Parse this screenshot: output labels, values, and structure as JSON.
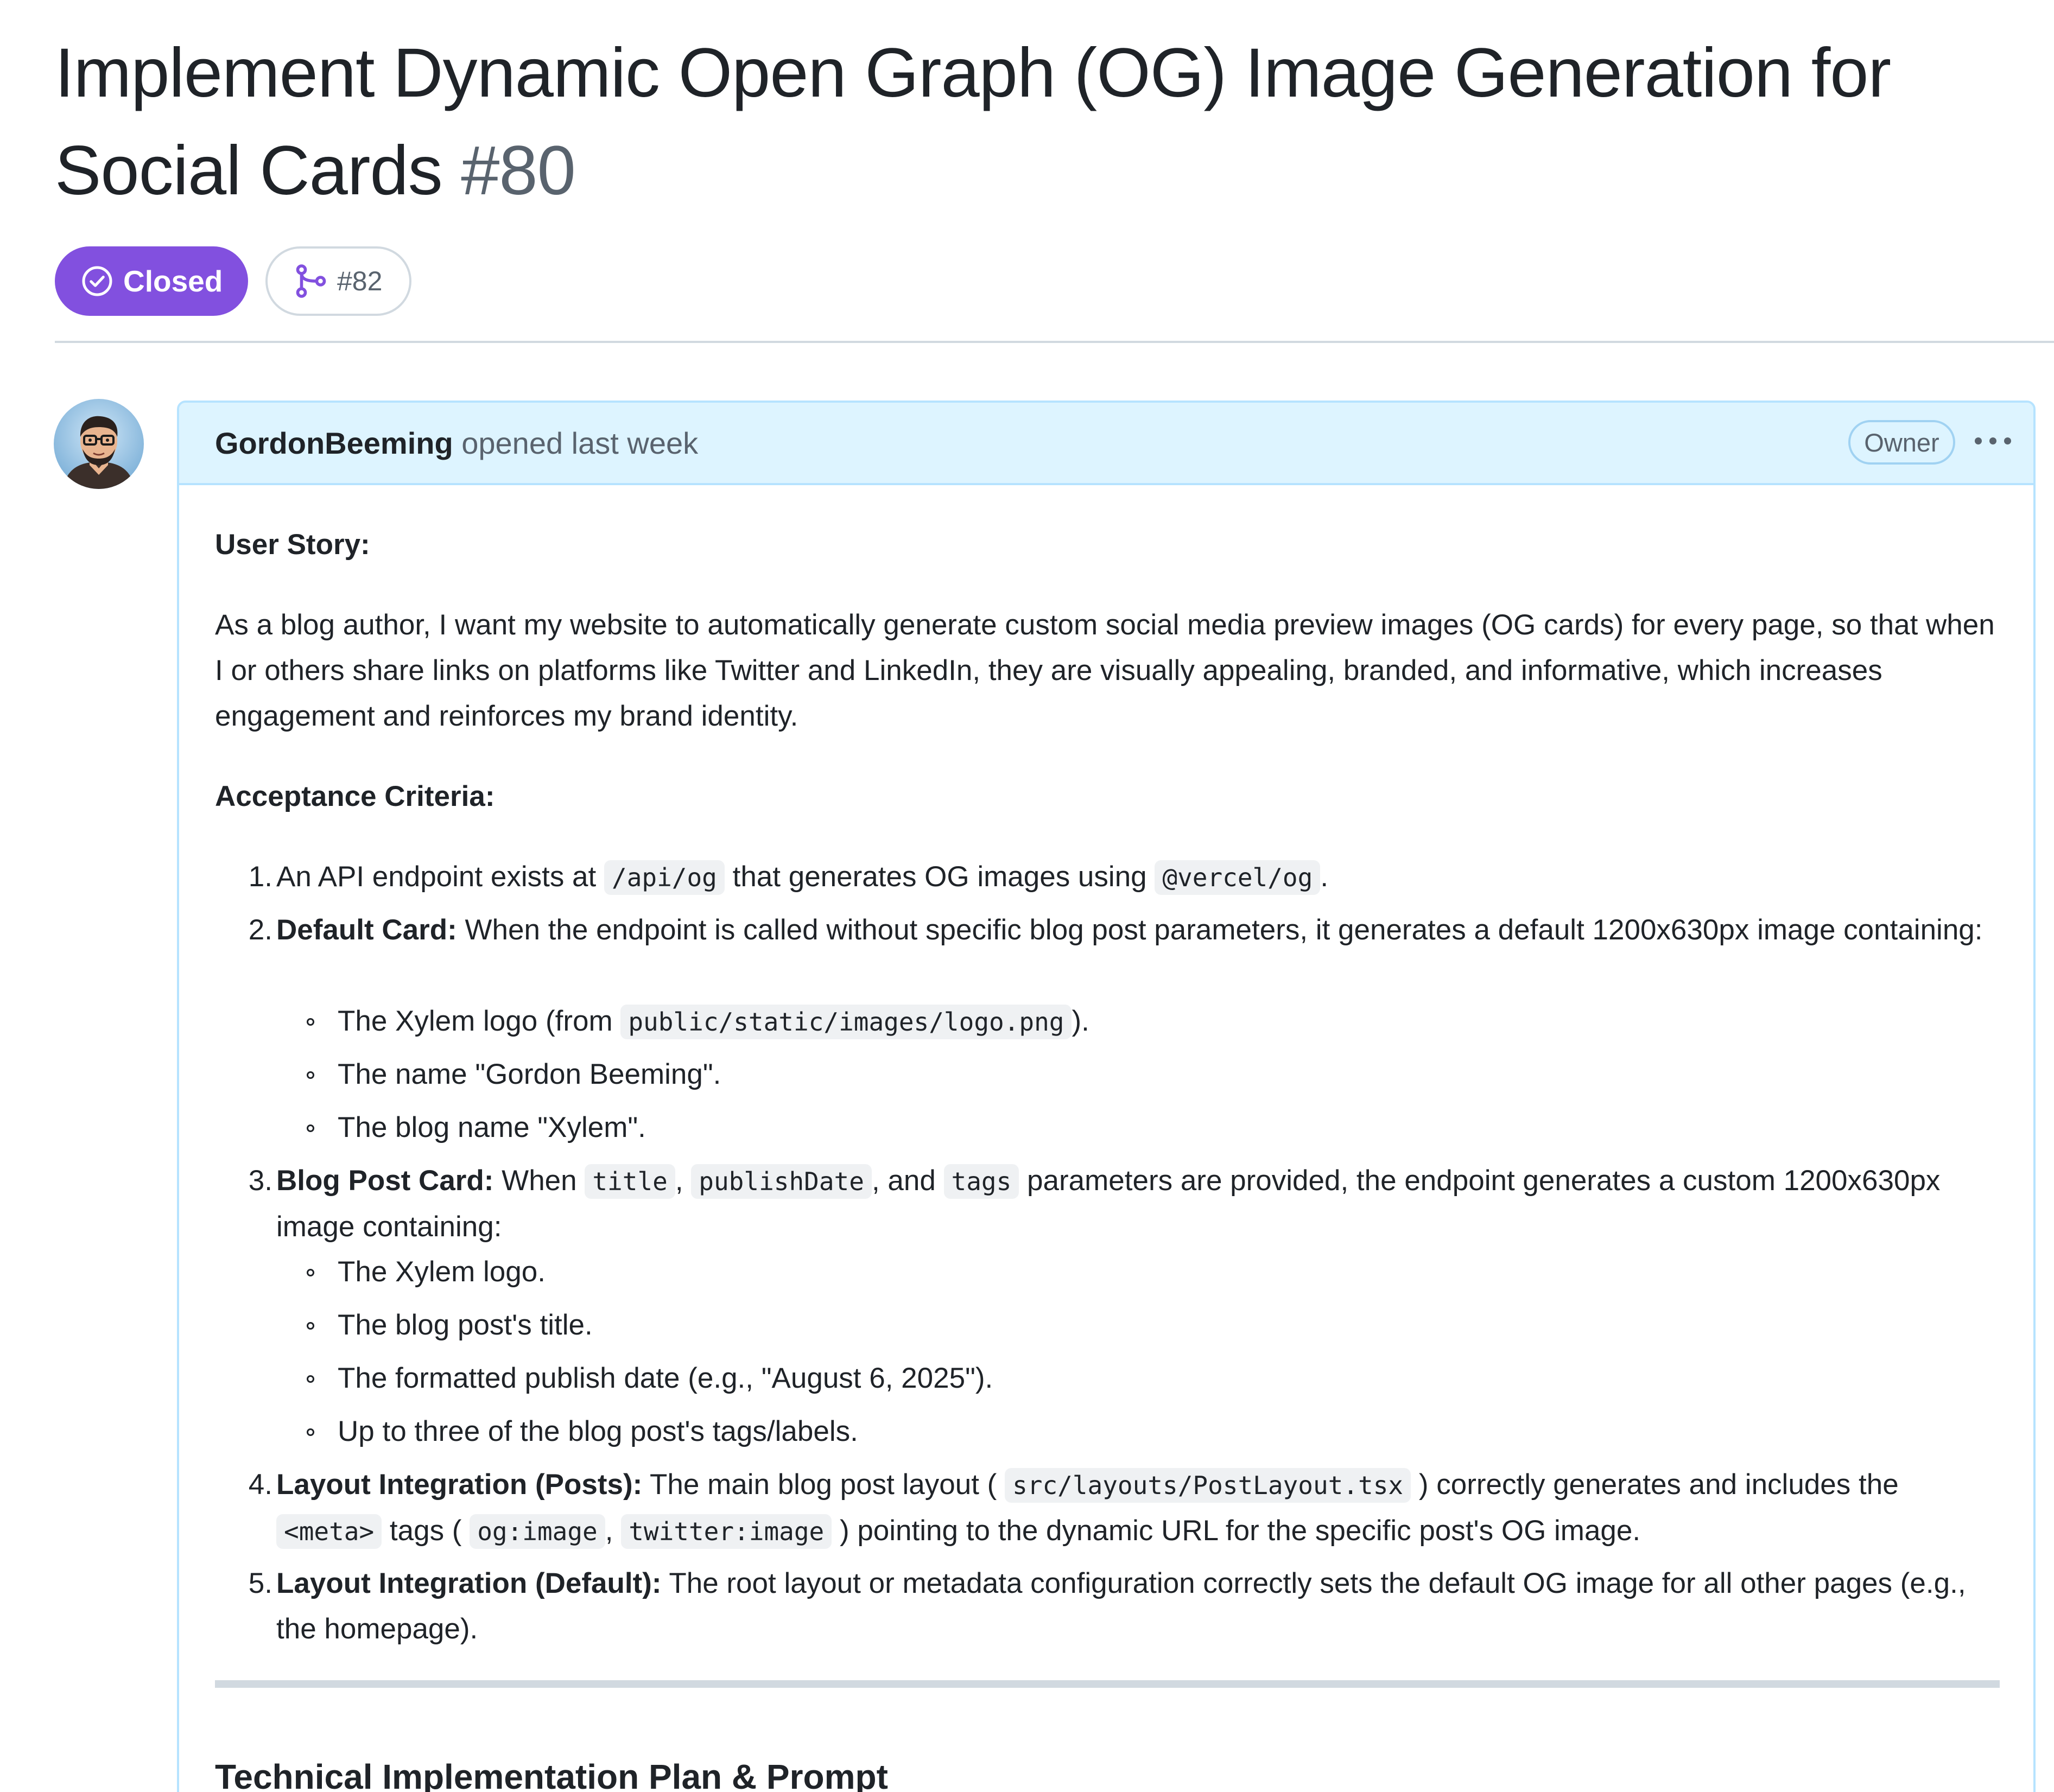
{
  "issue": {
    "title": "Implement Dynamic Open Graph (OG) Image Generation for Social Cards",
    "number": "#80",
    "state": "Closed",
    "linked_pr": "#82",
    "colors": {
      "state_badge": "#8250df",
      "header_bg": "#ddf4ff",
      "header_border": "#b6e3ff"
    }
  },
  "comment": {
    "author": "GordonBeeming",
    "action": "opened last week",
    "role_badge": "Owner",
    "more_icon": "kebab-horizontal-icon",
    "user_story_heading": "User Story:",
    "user_story_text": "As a blog author, I want my website to automatically generate custom social media preview images (OG cards) for every page, so that when I or others share links on platforms like Twitter and LinkedIn, they are visually appealing, branded, and informative, which increases engagement and reinforces my brand identity.",
    "acceptance_heading": "Acceptance Criteria:",
    "criteria": [
      {
        "num": "1.",
        "parts": {
          "t1": "An API endpoint exists at ",
          "c1": "/api/og",
          "t2": " that generates OG images using ",
          "c2": "@vercel/og",
          "t3": "."
        }
      },
      {
        "num": "2.",
        "bold": "Default Card:",
        "text": " When the endpoint is called without specific blog post parameters, it generates a default 1200x630px image containing:",
        "sub": [
          {
            "t1": "The Xylem logo (from ",
            "c1": "public/static/images/logo.png",
            "t2": ")."
          },
          {
            "t1": "The name \"Gordon Beeming\"."
          },
          {
            "t1": "The blog name \"Xylem\"."
          }
        ]
      },
      {
        "num": "3.",
        "bold": "Blog Post Card:",
        "parts": {
          "t1": " When ",
          "c1": "title",
          "t2": ", ",
          "c2": "publishDate",
          "t3": ", and ",
          "c3": "tags",
          "t4": " parameters are provided, the endpoint generates a custom 1200x630px image containing:"
        },
        "sub": [
          {
            "t1": "The Xylem logo."
          },
          {
            "t1": "The blog post's title."
          },
          {
            "t1": "The formatted publish date (e.g., \"August 6, 2025\")."
          },
          {
            "t1": "Up to three of the blog post's tags/labels."
          }
        ]
      },
      {
        "num": "4.",
        "bold": "Layout Integration (Posts):",
        "parts": {
          "t1": " The main blog post layout ( ",
          "c1": "src/layouts/PostLayout.tsx",
          "t2": " ) correctly generates and includes the ",
          "c2": "<meta>",
          "t3": " tags ( ",
          "c3": "og:image",
          "t4": ", ",
          "c4": "twitter:image",
          "t5": " ) pointing to the dynamic URL for the specific post's OG image."
        }
      },
      {
        "num": "5.",
        "bold": "Layout Integration (Default):",
        "text": " The root layout or metadata configuration correctly sets the default OG image for all other pages (e.g., the homepage)."
      }
    ],
    "next_heading": "Technical Implementation Plan & Prompt"
  }
}
